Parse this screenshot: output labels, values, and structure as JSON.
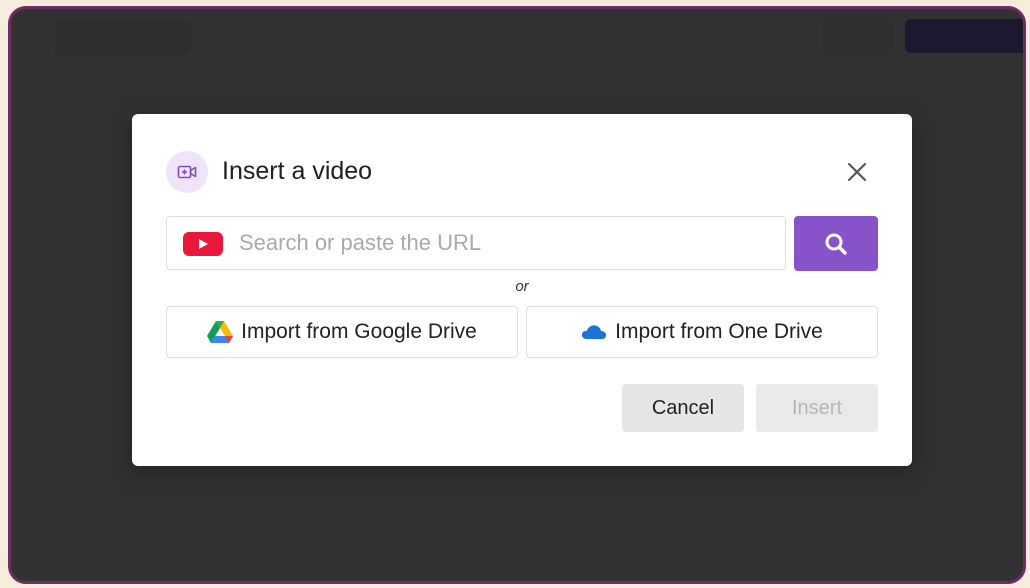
{
  "dialog": {
    "title": "Insert a video",
    "search": {
      "placeholder": "Search or paste the URL",
      "value": ""
    },
    "or_label": "or",
    "import_google_drive_label": "Import from Google Drive",
    "import_one_drive_label": "Import from One Drive",
    "cancel_label": "Cancel",
    "insert_label": "Insert",
    "insert_disabled": true
  },
  "icons": {
    "header": "video-plus-icon",
    "close": "close-icon",
    "source": "youtube-icon",
    "search": "search-icon",
    "google_drive": "google-drive-icon",
    "one_drive": "onedrive-cloud-icon"
  },
  "colors": {
    "accent": "#8654c8",
    "header_icon_bg": "#efe4f7",
    "frame_border": "#6e2b64",
    "backdrop": "#323232",
    "youtube_red": "#e8173b",
    "onedrive_blue": "#1a73d9"
  }
}
